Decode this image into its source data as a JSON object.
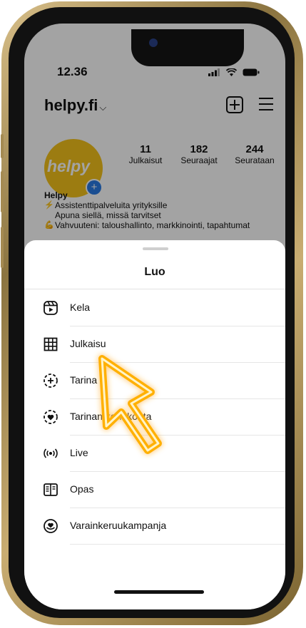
{
  "status_bar": {
    "time": "12.36"
  },
  "profile": {
    "username": "helpy.fi",
    "username_chevron": "⌵",
    "avatar_text": "helpy",
    "stats": [
      {
        "value": "11",
        "label": "Julkaisut"
      },
      {
        "value": "182",
        "label": "Seuraajat"
      },
      {
        "value": "244",
        "label": "Seurataan"
      }
    ],
    "name": "Helpy",
    "bio_lines": [
      {
        "emoji": "⚡",
        "text": "Assistenttipalveluita yrityksille"
      },
      {
        "emoji": "",
        "text": "Apuna siellä, missä tarvitset"
      },
      {
        "emoji": "💪",
        "text": "Vahvuuteni: taloushallinto, markkinointi, tapahtumat"
      }
    ]
  },
  "sheet": {
    "title": "Luo",
    "items": [
      {
        "label": "Kela",
        "icon": "reels-icon"
      },
      {
        "label": "Julkaisu",
        "icon": "grid-icon"
      },
      {
        "label": "Tarina",
        "icon": "story-add-icon"
      },
      {
        "label": "Tarinan kohokohta",
        "icon": "story-highlight-icon"
      },
      {
        "label": "Live",
        "icon": "live-icon"
      },
      {
        "label": "Opas",
        "icon": "guide-icon"
      },
      {
        "label": "Varainkeruukampanja",
        "icon": "fundraiser-icon"
      }
    ]
  },
  "colors": {
    "avatar_yellow": "#f4c21b",
    "arrow_glow": "#ffb000",
    "phone_gold": "#c9ad72"
  }
}
